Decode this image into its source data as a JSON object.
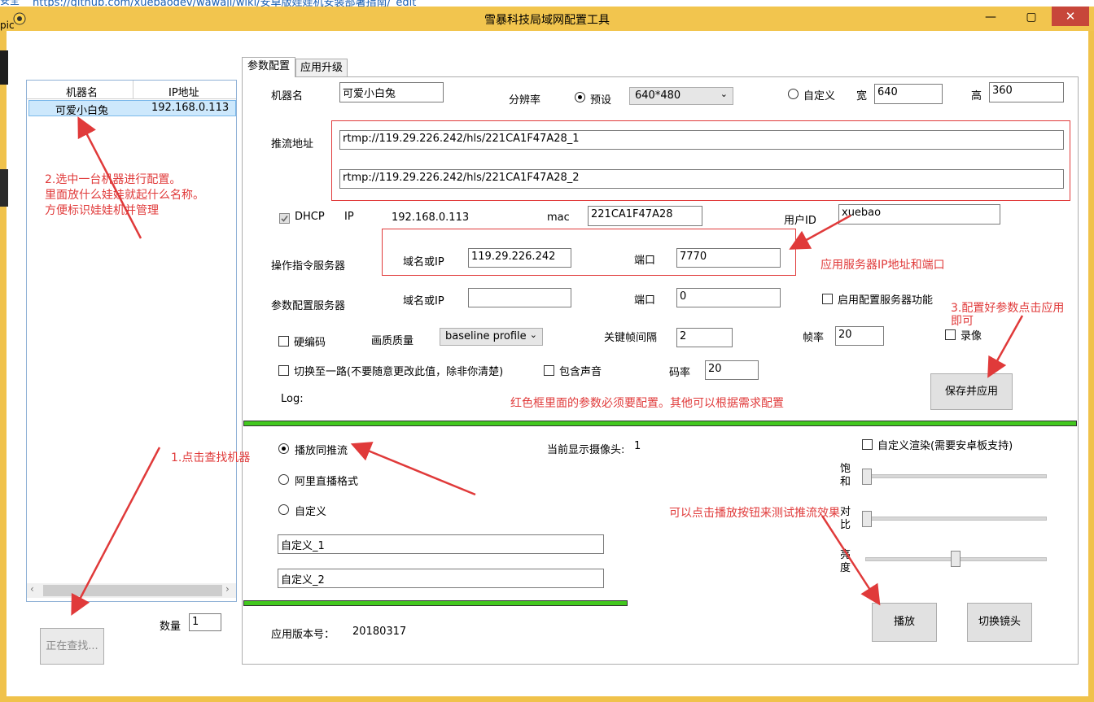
{
  "browser": {
    "url": "https://github.com/xuebaodev/wawaji/wiki/安卓版娃娃机安装部署指南/_edit",
    "left_frag": "安全",
    "left_frag2": "pic"
  },
  "window": {
    "title": "雪暴科技局域网配置工具",
    "minimize": "—",
    "maximize": "▢",
    "close": "✕"
  },
  "left_panel": {
    "list_headers": [
      "机器名",
      "IP地址"
    ],
    "rows": [
      {
        "name": "可爱小白兔",
        "ip": "192.168.0.113"
      }
    ],
    "scroll_left": "‹",
    "scroll_right": "›",
    "count_label": "数量",
    "count_value": "1",
    "search_button": "正在查找..."
  },
  "tabs": [
    "参数配置",
    "应用升级"
  ],
  "config": {
    "machine_name_label": "机器名",
    "machine_name_value": "可爱小白兔",
    "resolution_label": "分辨率",
    "preset_label": "预设",
    "preset_value": "640*480",
    "custom_label": "自定义",
    "width_label": "宽",
    "width_value": "640",
    "height_label": "高",
    "height_value": "360",
    "push_url_label": "推流地址",
    "push_url_1": "rtmp://119.29.226.242/hls/221CA1F47A28_1",
    "push_url_2": "rtmp://119.29.226.242/hls/221CA1F47A28_2",
    "dhcp_label": "DHCP",
    "ip_label": "IP",
    "ip_value": "192.168.0.113",
    "mac_label": "mac",
    "mac_value": "221CA1F47A28",
    "user_id_label": "用户ID",
    "user_id_value": "xuebao",
    "cmd_server_label": "操作指令服务器",
    "domain_label": "域名或IP",
    "cmd_server_ip": "119.29.226.242",
    "port_label": "端口",
    "cmd_server_port": "7770",
    "param_server_label": "参数配置服务器",
    "param_server_ip": "",
    "param_server_port": "0",
    "enable_config_server": "启用配置服务器功能",
    "hw_encode": "硬编码",
    "quality_label": "画质质量",
    "quality_value": "baseline profile",
    "keyframe_label": "关键帧间隔",
    "keyframe_value": "2",
    "fps_label": "帧率",
    "fps_value": "20",
    "record_label": "录像",
    "single_route": "切换至一路(不要随意更改此值，除非你清楚)",
    "include_audio": "包含声音",
    "bitrate_label": "码率",
    "bitrate_value": "20",
    "log_label": "Log:",
    "save_button": "保存并应用"
  },
  "preview": {
    "opt_play_push": "播放同推流",
    "opt_ali": "阿里直播格式",
    "opt_custom": "自定义",
    "custom_1": "自定义_1",
    "custom_2": "自定义_2",
    "camera_label": "当前显示摄像头:",
    "camera_value": "1",
    "custom_render": "自定义渲染(需要安卓板支持)",
    "saturation_label": "饱和",
    "contrast_label": "对比",
    "brightness_label": "亮度",
    "play_button": "播放",
    "switch_camera_button": "切换镜头",
    "version_label": "应用版本号：",
    "version_value": "20180317"
  },
  "annotations": {
    "a1": "1.点击查找机器",
    "a2_line1": "2.选中一台机器进行配置。",
    "a2_line2": "里面放什么娃娃就起什么名称。",
    "a2_line3": "方便标识娃娃机并管理",
    "a3_line1": "3.配置好参数点击应用",
    "a3_line2": "即可",
    "a4": "应用服务器IP地址和端口",
    "a5": "红色框里面的参数必须要配置。其他可以根据需求配置",
    "a6": "可以点击播放按钮来测试推流效果"
  },
  "colors": {
    "annotation": "#e03a3a",
    "titlebar": "#f2c54e",
    "progress": "#42c81e",
    "selection": "#cde8fc"
  }
}
